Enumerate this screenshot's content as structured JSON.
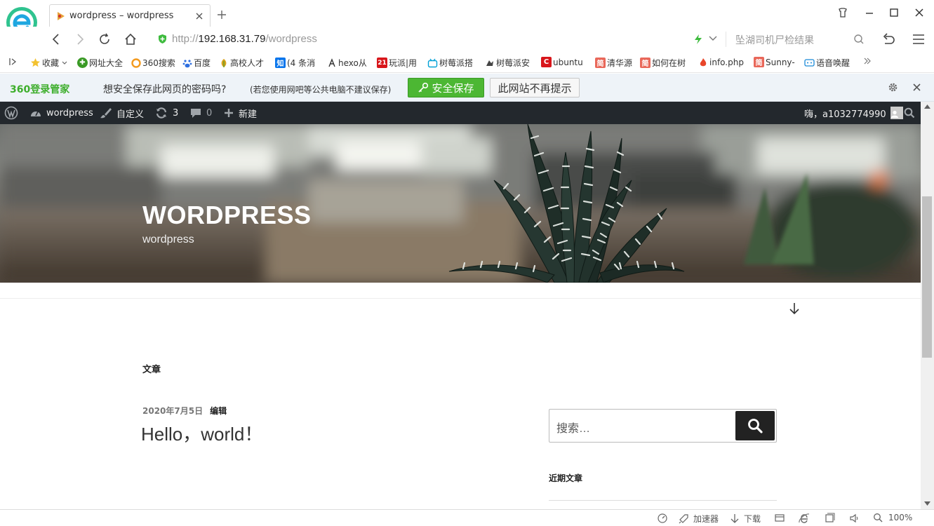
{
  "browser": {
    "tab_title": "wordpress – wordpress",
    "url_prefix": "http://",
    "url_host": "192.168.31.79",
    "url_path": "/wordpress",
    "search_placeholder": "坠湖司机尸检结果"
  },
  "bookmarks": [
    {
      "label": "收藏",
      "icon": "star-icon"
    },
    {
      "label": "网址大全",
      "icon": "nav-icon"
    },
    {
      "label": "360搜索",
      "icon": "360-search-icon"
    },
    {
      "label": "百度",
      "icon": "baidu-icon"
    },
    {
      "label": "高校人才",
      "icon": "leaf-icon"
    },
    {
      "label": "(4 条消",
      "icon": "zhihu-icon",
      "badge": "知"
    },
    {
      "label": "hexo从",
      "icon": "hexo-icon"
    },
    {
      "label": "玩派|用",
      "icon": "21-icon",
      "badge": "21"
    },
    {
      "label": "树莓派搭",
      "icon": "bilibili-icon"
    },
    {
      "label": "树莓派安",
      "icon": "bird-icon"
    },
    {
      "label": "ubuntu",
      "icon": "csdn-icon",
      "badge": "C"
    },
    {
      "label": "清华源",
      "icon": "jianshu-icon",
      "badge": "简"
    },
    {
      "label": "如何在树",
      "icon": "jianshu-icon",
      "badge": "简"
    },
    {
      "label": "info.php",
      "icon": "fire-icon"
    },
    {
      "label": "Sunny-",
      "icon": "jianshu-icon",
      "badge": "简"
    },
    {
      "label": "语音唤醒",
      "icon": "chat-icon"
    }
  ],
  "password_bar": {
    "brand": "360登录管家",
    "question": "想安全保存此网页的密码吗?",
    "note": "(若您使用网吧等公共电脑不建议保存)",
    "save_label": "安全保存",
    "never_label": "此网站不再提示"
  },
  "admin_bar": {
    "site_name": "wordpress",
    "customize": "自定义",
    "updates": "3",
    "comments": "0",
    "new": "新建",
    "greeting": "嗨，a1032774990"
  },
  "site": {
    "title": "WORDPRESS",
    "description": "wordpress"
  },
  "main": {
    "page_heading": "文章",
    "post_date": "2020年7月5日",
    "edit_label": "编辑",
    "post_title": "Hello，world！"
  },
  "sidebar": {
    "search_placeholder": "搜索…",
    "recent_heading": "近期文章"
  },
  "statusbar": {
    "accelerator": "加速器",
    "download": "下载",
    "zoom": "100%"
  },
  "colors": {
    "admin_bar_bg": "#23282d",
    "save_button": "#4cb733",
    "brand_green": "#3dae2b"
  }
}
